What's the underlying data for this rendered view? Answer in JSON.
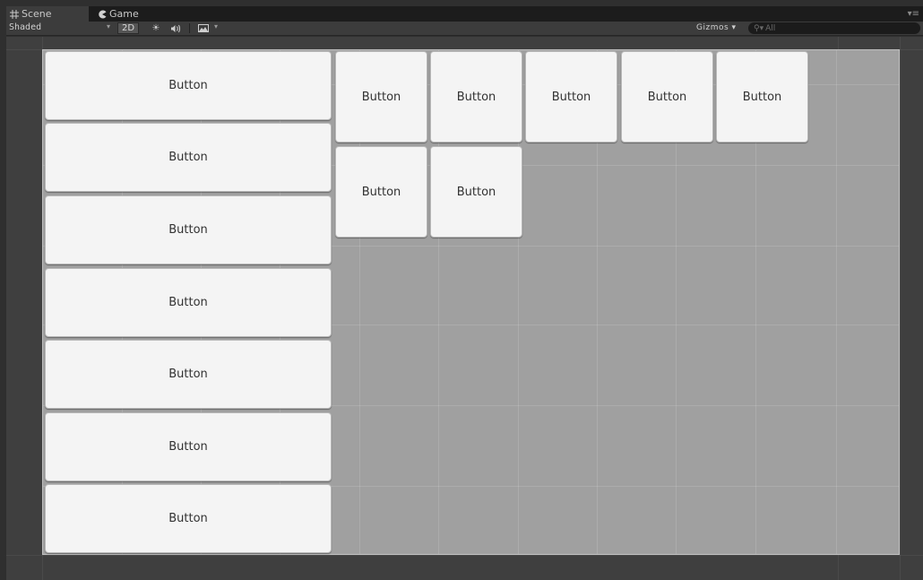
{
  "tabs": {
    "scene_label": "Scene",
    "game_label": "Game"
  },
  "toolbar": {
    "shading_mode": "Shaded",
    "mode_2d_label": "2D",
    "gizmos_label": "Gizmos",
    "search_placeholder": "All"
  },
  "canvas": {
    "left_column_buttons": [
      {
        "label": "Button"
      },
      {
        "label": "Button"
      },
      {
        "label": "Button"
      },
      {
        "label": "Button"
      },
      {
        "label": "Button"
      },
      {
        "label": "Button"
      },
      {
        "label": "Button"
      }
    ],
    "grid_buttons": [
      {
        "label": "Button"
      },
      {
        "label": "Button"
      },
      {
        "label": "Button"
      },
      {
        "label": "Button"
      },
      {
        "label": "Button"
      },
      {
        "label": "Button"
      },
      {
        "label": "Button"
      }
    ]
  },
  "colors": {
    "panel_background": "#a0a0a0",
    "button_face": "#f4f4f4",
    "editor_background": "#3f3f3f"
  }
}
